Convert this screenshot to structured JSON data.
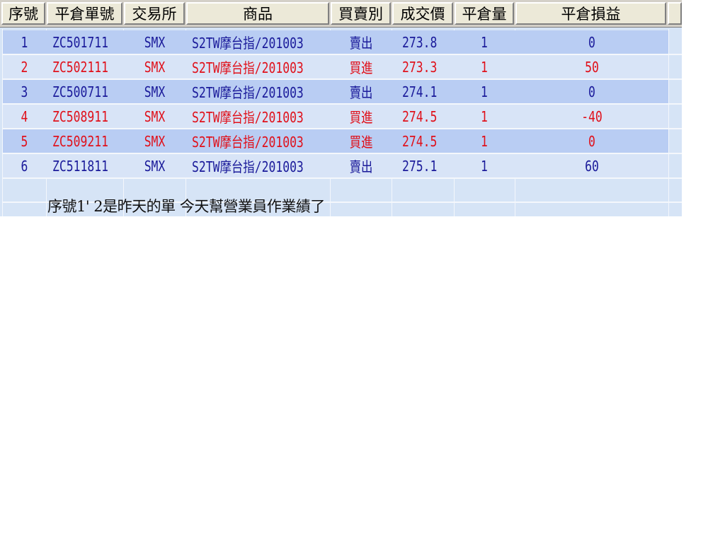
{
  "table": {
    "columns": [
      "序號",
      "平倉單號",
      "交易所",
      "商品",
      "買賣別",
      "成交價",
      "平倉量",
      "平倉損益"
    ],
    "rows": [
      {
        "seq": "1",
        "order_no": "ZC501711",
        "exchange": "SMX",
        "product": "S2TW摩台指/201003",
        "side": "賣出",
        "price": "273.8",
        "qty": "1",
        "pnl": "0",
        "color": "#1a1a9a"
      },
      {
        "seq": "2",
        "order_no": "ZC502111",
        "exchange": "SMX",
        "product": "S2TW摩台指/201003",
        "side": "買進",
        "price": "273.3",
        "qty": "1",
        "pnl": "50",
        "color": "#e0101a"
      },
      {
        "seq": "3",
        "order_no": "ZC500711",
        "exchange": "SMX",
        "product": "S2TW摩台指/201003",
        "side": "賣出",
        "price": "274.1",
        "qty": "1",
        "pnl": "0",
        "color": "#1a1a9a"
      },
      {
        "seq": "4",
        "order_no": "ZC508911",
        "exchange": "SMX",
        "product": "S2TW摩台指/201003",
        "side": "買進",
        "price": "274.5",
        "qty": "1",
        "pnl": "-40",
        "color": "#e0101a"
      },
      {
        "seq": "5",
        "order_no": "ZC509211",
        "exchange": "SMX",
        "product": "S2TW摩台指/201003",
        "side": "買進",
        "price": "274.5",
        "qty": "1",
        "pnl": "0",
        "color": "#e0101a"
      },
      {
        "seq": "6",
        "order_no": "ZC511811",
        "exchange": "SMX",
        "product": "S2TW摩台指/201003",
        "side": "賣出",
        "price": "275.1",
        "qty": "1",
        "pnl": "60",
        "color": "#1a1a9a"
      }
    ]
  },
  "note": "序號1' 2是昨天的單   今天幫營業員作業績了",
  "colors": {
    "sell": "#1a1a9a",
    "buy": "#e0101a",
    "row_shade": "#b9cdf3",
    "row_plain": "#d8e4f7"
  }
}
